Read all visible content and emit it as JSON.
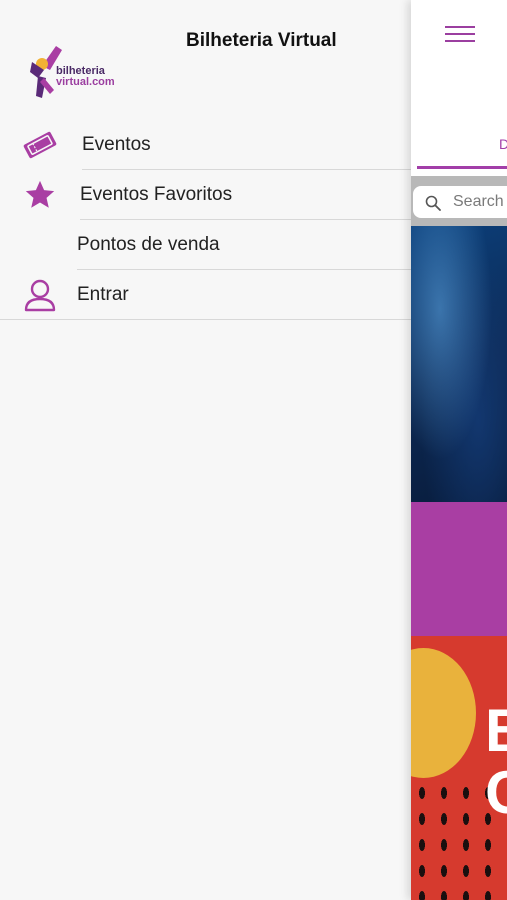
{
  "drawer": {
    "title": "Bilheteria Virtual",
    "logo": {
      "line1": "bilheteria",
      "line2": "virtual.com"
    },
    "items": [
      {
        "label": "Eventos",
        "icon": "ticket-icon"
      },
      {
        "label": "Eventos Favoritos",
        "icon": "star-icon"
      },
      {
        "label": "Pontos de venda",
        "icon": ""
      },
      {
        "label": "Entrar",
        "icon": "user-icon"
      }
    ]
  },
  "main": {
    "tab_partial": "D",
    "search_placeholder": "Search",
    "image3_glyphs": "B\nC"
  },
  "colors": {
    "accent": "#a23ea8",
    "banner": "#a93ea3",
    "background": "#f7f7f7"
  }
}
